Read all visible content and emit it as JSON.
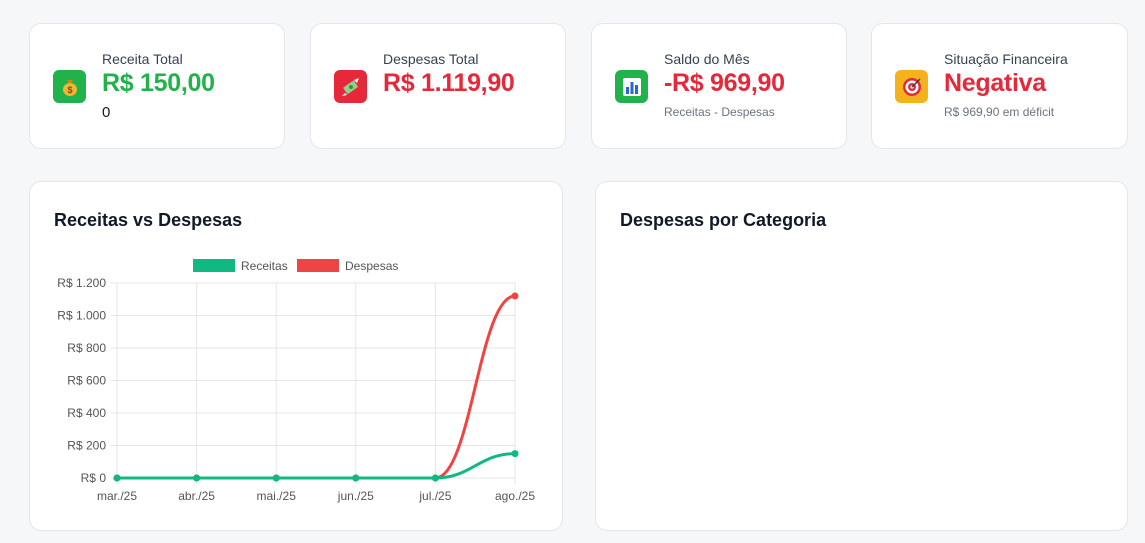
{
  "stats": [
    {
      "label": "Receita Total",
      "value": "R$ 150,00",
      "sub": "0",
      "icon": "money-bag-icon",
      "color": "#22b24c"
    },
    {
      "label": "Despesas Total",
      "value": "R$ 1.119,90",
      "sub": "",
      "icon": "money-with-wings-icon",
      "color": "#e5283a"
    },
    {
      "label": "Saldo do Mês",
      "value": "-R$ 969,90",
      "sub": "Receitas - Despesas",
      "icon": "bar-chart-icon",
      "color": "#e5283a"
    },
    {
      "label": "Situação Financeira",
      "value": "Negativa",
      "sub": "R$ 969,90 em déficit",
      "icon": "target-icon",
      "color": "#e5283a"
    }
  ],
  "panels": {
    "revenue_vs_expenses_title": "Receitas vs Despesas",
    "expenses_by_category_title": "Despesas por Categoria"
  },
  "chart_data": {
    "type": "line",
    "categories": [
      "mar./25",
      "abr./25",
      "mai./25",
      "jun./25",
      "jul./25",
      "ago./25"
    ],
    "series": [
      {
        "name": "Receitas",
        "values": [
          0,
          0,
          0,
          0,
          0,
          150
        ],
        "color": "#10b981"
      },
      {
        "name": "Despesas",
        "values": [
          0,
          0,
          0,
          0,
          0,
          1119.9
        ],
        "color": "#ef4444"
      }
    ],
    "yticks": [
      "R$ 0",
      "R$ 200",
      "R$ 400",
      "R$ 600",
      "R$ 800",
      "R$ 1.000",
      "R$ 1.200"
    ],
    "ylim": [
      0,
      1200
    ],
    "grid": true,
    "legend": "top"
  }
}
